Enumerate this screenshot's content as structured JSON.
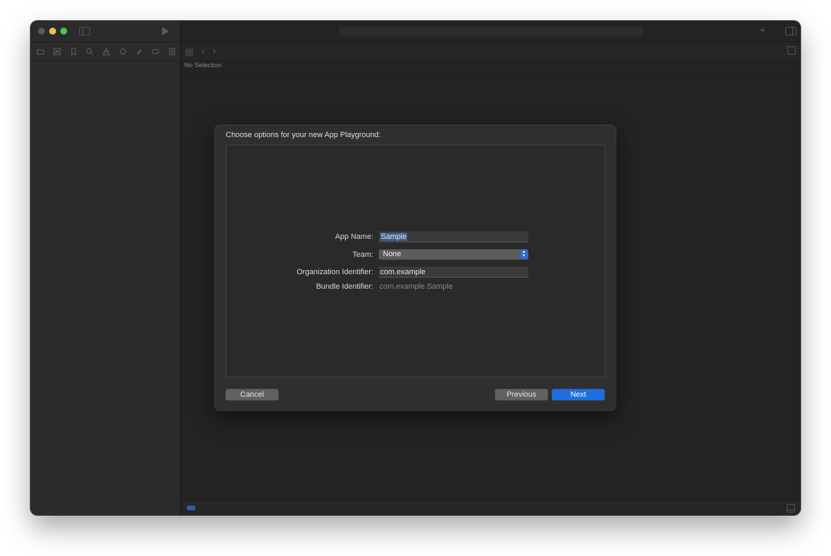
{
  "editor": {
    "jump_bar": "No Selection"
  },
  "sheet": {
    "title": "Choose options for your new App Playground:",
    "fields": {
      "app_name": {
        "label": "App Name:",
        "value": "Sample"
      },
      "team": {
        "label": "Team:",
        "value": "None"
      },
      "organization_identifier": {
        "label": "Organization Identifier:",
        "value": "com.example"
      },
      "bundle_identifier": {
        "label": "Bundle Identifier:",
        "value": "com.example.Sample"
      }
    },
    "buttons": {
      "cancel": "Cancel",
      "previous": "Previous",
      "next": "Next"
    }
  },
  "colors": {
    "window_bg": "#242424",
    "sidebar_bg": "#2b2b2b",
    "accent": "#1f6ee0",
    "traffic_minimize": "#f3bd4f",
    "traffic_maximize": "#4fc24f"
  },
  "icons": {
    "navigator": [
      "folder-icon",
      "source-control-icon",
      "bookmark-icon",
      "search-icon",
      "warning-icon",
      "test-icon",
      "debug-icon",
      "breakpoint-icon",
      "report-icon"
    ],
    "toolbar": [
      "sidebar-toggle-icon",
      "run-icon",
      "add-icon",
      "inspector-toggle-icon"
    ]
  }
}
